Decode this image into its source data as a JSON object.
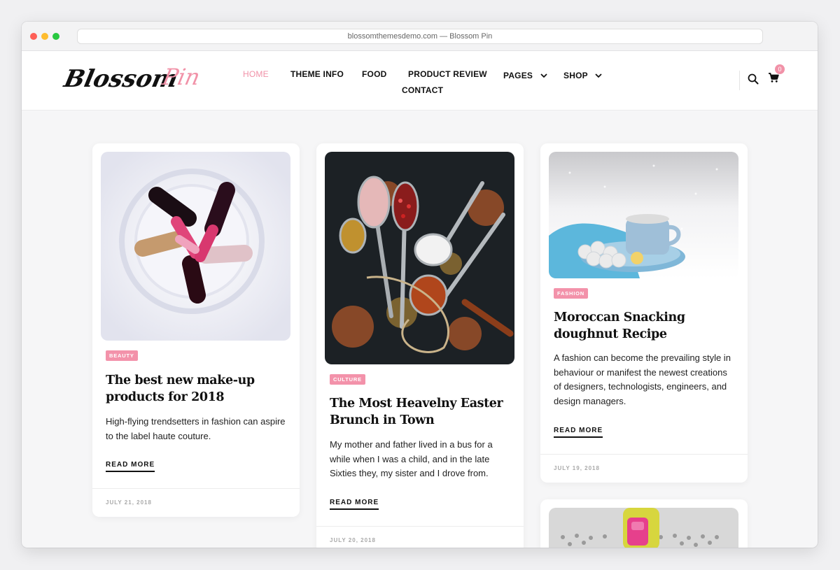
{
  "browser": {
    "url_title": "blossomthemesdemo.com — Blossom Pin"
  },
  "header": {
    "logo_text_dark": "Blossom",
    "logo_text_pink": "Pin",
    "nav": [
      "HOME",
      "THEME INFO",
      "FOOD",
      "PRODUCT REVIEW",
      "PAGES",
      "SHOP",
      "CONTACT"
    ],
    "cart_count": "0",
    "accent_color": "#f192a8"
  },
  "posts": [
    {
      "tag": "BEAUTY",
      "title": "The best new make-up products for 2018",
      "excerpt": "High-flying trendsetters in fashion can aspire to the label haute couture.",
      "read_more": "READ MORE",
      "date": "JULY 21, 2018",
      "image": "lipsticks-in-glass-jar"
    },
    {
      "tag": "CULTURE",
      "title": "The Most Heavelny Easter Brunch in Town",
      "excerpt": "My mother and father lived in a bus for a while when I was a child, and in the late Sixties they, my sister and I drove from.",
      "read_more": "READ MORE",
      "date": "JULY 20, 2018",
      "image": "spices-and-spoons"
    },
    {
      "tag": "FASHION",
      "title": "Moroccan Snacking doughnut Recipe",
      "excerpt": "A fashion can become the prevailing style in behaviour or manifest the newest creations of designers, technologists, engineers, and design managers.",
      "read_more": "READ MORE",
      "date": "JULY 19, 2018",
      "image": "tea-cup-in-snow"
    },
    {
      "image": "pink-backpack"
    }
  ]
}
